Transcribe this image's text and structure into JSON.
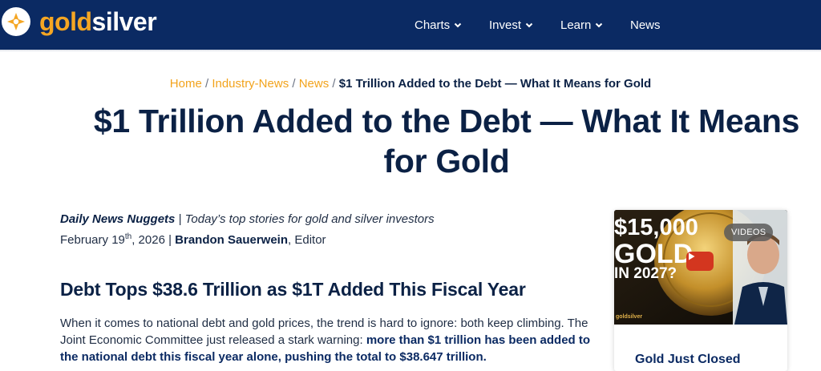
{
  "header": {
    "logo": {
      "gold": "gold",
      "silver": "silver",
      "icon": "star-coin-icon"
    },
    "nav": [
      {
        "label": "Charts",
        "has_dropdown": true
      },
      {
        "label": "Invest",
        "has_dropdown": true
      },
      {
        "label": "Learn",
        "has_dropdown": true
      },
      {
        "label": "News",
        "has_dropdown": false
      }
    ]
  },
  "breadcrumb": {
    "items": [
      "Home",
      "Industry-News",
      "News"
    ],
    "separator": "/",
    "current": "$1 Trillion Added to the Debt — What It Means for Gold"
  },
  "article": {
    "title_line1": "$1 Trillion Added to the Debt — What It Means",
    "title_line2": "for Gold",
    "series": "Daily News Nuggets",
    "series_sep": " | ",
    "tagline": "Today’s top stories for gold and silver investors",
    "date_prefix": "February 19",
    "date_suffix": "th",
    "date_year": ", 2026 | ",
    "author": "Brandon Sauerwein",
    "author_role": ", Editor",
    "heading": "Debt Tops $38.6 Trillion as $1T Added This Fiscal Year",
    "para_plain": "When it comes to national debt and gold prices, the trend is hard to ignore: both keep climbing. The Joint Economic Committee just released a stark warning: ",
    "para_bold": "more than $1 trillion has been added to the national debt this fiscal year alone, pushing the total to $38.647 trillion."
  },
  "sidebar": {
    "thumb_line1": "$15,000",
    "thumb_line2": "GOLD",
    "thumb_line3": "IN 2027?",
    "badge": "VIDEOS",
    "thumb_logo": "goldsilver",
    "card_title": "Gold Just Closed"
  },
  "colors": {
    "header_bg": "#0b2a63",
    "accent_gold": "#f5a623",
    "text_navy": "#0b2145",
    "play_red": "#d3361f"
  }
}
